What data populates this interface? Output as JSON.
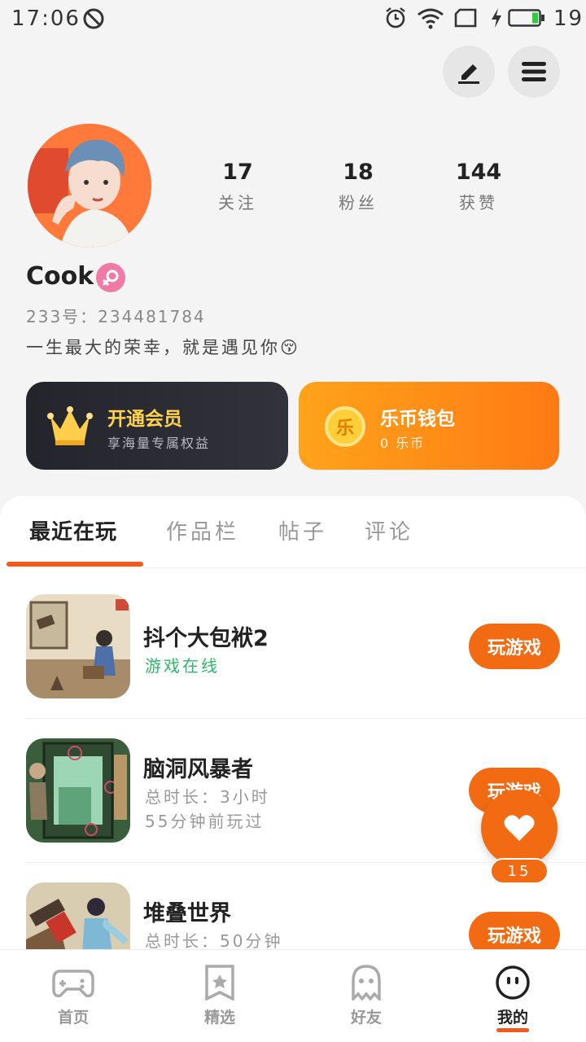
{
  "status_bar": {
    "time": "17:06",
    "battery": "19"
  },
  "profile": {
    "stats": [
      {
        "value": "17",
        "label": "关注"
      },
      {
        "value": "18",
        "label": "粉丝"
      },
      {
        "value": "144",
        "label": "获赞"
      }
    ],
    "username": "Cook",
    "gender_icon": "female-icon",
    "uid": "233号：234481784",
    "bio": "一生最大的荣幸，就是遇见你😚"
  },
  "cards": {
    "vip": {
      "title": "开通会员",
      "subtitle": "享海量专属权益"
    },
    "wallet": {
      "title": "乐币钱包",
      "subtitle": "0 乐币",
      "coin_char": "乐"
    }
  },
  "tabs": [
    "最近在玩",
    "作品栏",
    "帖子",
    "评论"
  ],
  "games": [
    {
      "title": "抖个大包袱2",
      "line1": "游戏在线",
      "line2": "",
      "button": "玩游戏"
    },
    {
      "title": "脑洞风暴者",
      "line1": "总时长：3小时",
      "line2": "55分钟前玩过",
      "button": "玩游戏"
    },
    {
      "title": "堆叠世界",
      "line1": "总时长：50分钟",
      "line2": "",
      "button": "玩游戏"
    }
  ],
  "like": {
    "count": "15"
  },
  "bottom_nav": [
    {
      "label": "首页",
      "icon": "gamepad-icon"
    },
    {
      "label": "精选",
      "icon": "star-badge-icon"
    },
    {
      "label": "好友",
      "icon": "ghost-icon"
    },
    {
      "label": "我的",
      "icon": "face-icon"
    }
  ],
  "colors": {
    "accent": "#f26a12",
    "online_green": "#2db86a",
    "vip_gold": "#ffd34d"
  }
}
